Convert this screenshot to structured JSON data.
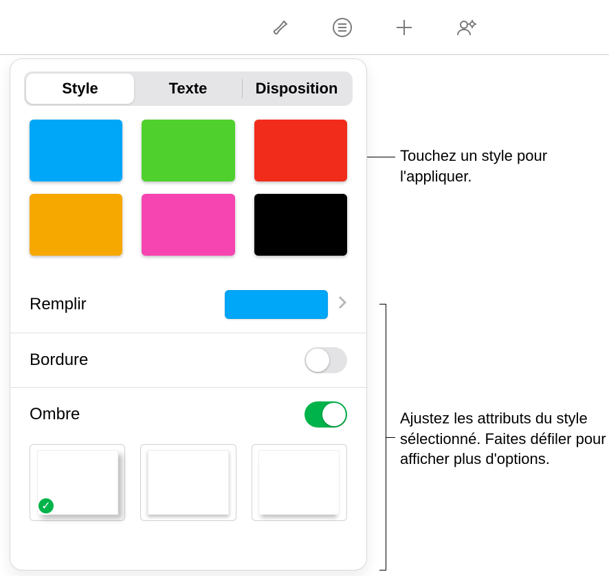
{
  "tabs": {
    "style": "Style",
    "text": "Texte",
    "layout": "Disposition"
  },
  "presets": {
    "colors": [
      "#00a6f8",
      "#4fd02c",
      "#f12c1b",
      "#f7a800",
      "#f644b1",
      "#000000"
    ]
  },
  "rows": {
    "fill": {
      "label": "Remplir",
      "swatch_color": "#00a6f8"
    },
    "border": {
      "label": "Bordure",
      "on": false
    },
    "shadow": {
      "label": "Ombre",
      "on": true,
      "selected": 0
    }
  },
  "callouts": {
    "apply": "Touchez un style pour l'appliquer.",
    "adjust": "Ajustez les attributs du style sélectionné. Faites défiler pour afficher plus d'options."
  }
}
